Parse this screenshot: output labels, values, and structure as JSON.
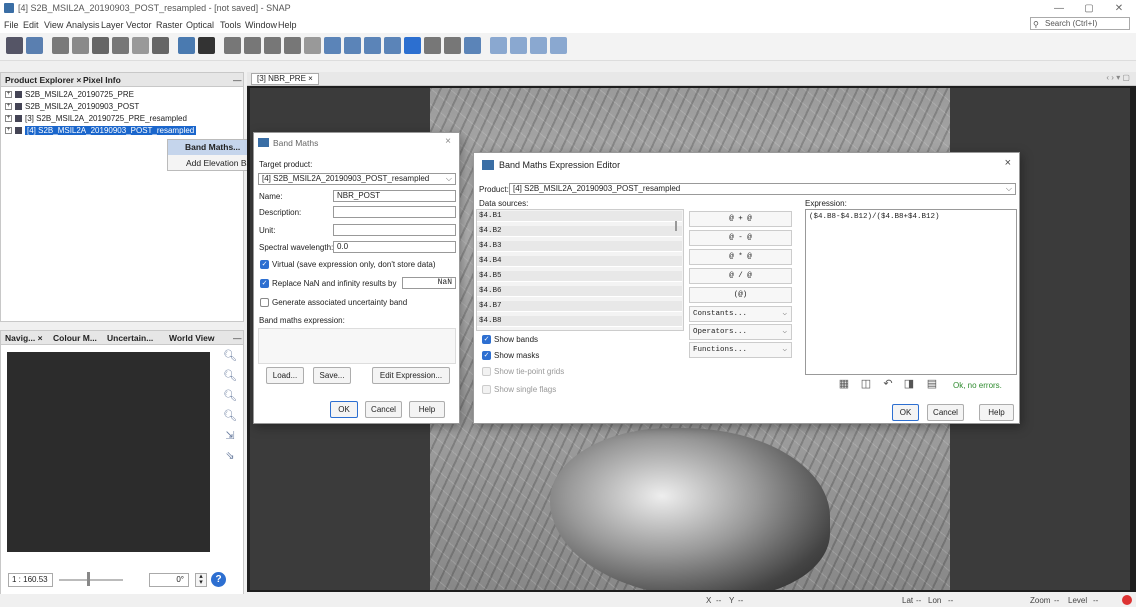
{
  "window": {
    "title": "[4] S2B_MSIL2A_20190903_POST_resampled - [not saved] - SNAP",
    "controls": [
      "—",
      "▢",
      "✕"
    ]
  },
  "menu": [
    "File",
    "Edit",
    "View",
    "Analysis",
    "Layer",
    "Vector",
    "Raster",
    "Optical",
    "Tools",
    "Window",
    "Help"
  ],
  "search": {
    "placeholder": "Search (Ctrl+I)"
  },
  "product_explorer": {
    "tabs": [
      "Product Explorer ×",
      "Pixel Info"
    ],
    "products": [
      "S2B_MSIL2A_20190725_PRE",
      "S2B_MSIL2A_20190903_POST",
      "[3] S2B_MSIL2A_20190725_PRE_resampled",
      "[4] S2B_MSIL2A_20190903_POST_resampled"
    ]
  },
  "context_menu": {
    "items": [
      "Band Maths...",
      "Add Elevation Ba"
    ]
  },
  "nav_panel": {
    "tabs": [
      "Navig... ×",
      "Colour M...",
      "Uncertain...",
      "World View"
    ],
    "scale": "1 : 160.53",
    "rotation": "0°"
  },
  "document_tab": {
    "label": "[3] NBR_PRE ×"
  },
  "band_maths": {
    "title": "Band Maths",
    "target_product_label": "Target product:",
    "target_product": "[4] S2B_MSIL2A_20190903_POST_resampled",
    "name_label": "Name:",
    "name_value": "NBR_POST",
    "description_label": "Description:",
    "unit_label": "Unit:",
    "wavelength_label": "Spectral wavelength:",
    "wavelength_value": "0.0",
    "virtual_label": "Virtual (save expression only, don't store data)",
    "replace_nan_label": "Replace NaN and infinity results by",
    "replace_nan_value": "NaN",
    "uncertainty_label": "Generate associated uncertainty band",
    "expression_label": "Band maths expression:",
    "load_button": "Load...",
    "save_button": "Save...",
    "edit_button": "Edit Expression...",
    "ok_button": "OK",
    "cancel_button": "Cancel",
    "help_button": "Help"
  },
  "expression_editor": {
    "title": "Band Maths Expression Editor",
    "product_label": "Product:",
    "product_value": "[4] S2B_MSIL2A_20190903_POST_resampled",
    "data_sources_label": "Data sources:",
    "data_sources": [
      "$4.B1",
      "$4.B2",
      "$4.B3",
      "$4.B4",
      "$4.B5",
      "$4.B6",
      "$4.B7",
      "$4.B8"
    ],
    "operators": [
      "@ + @",
      "@ - @",
      "@ * @",
      "@ / @",
      "(@)"
    ],
    "dropdowns": [
      "Constants...",
      "Operators...",
      "Functions..."
    ],
    "show_bands": "Show bands",
    "show_masks": "Show masks",
    "show_tie_point_grids": "Show tie-point grids",
    "show_single_flags": "Show single flags",
    "expression_label": "Expression:",
    "expression": "($4.B8-$4.B12)/($4.B8+$4.B12)",
    "status": "Ok, no errors.",
    "status_color": "#2e8b2e",
    "ok_button": "OK",
    "cancel_button": "Cancel",
    "help_button": "Help"
  },
  "statusbar": {
    "x": "X",
    "x_val": "--",
    "y": "Y",
    "y_val": "--",
    "lat": "Lat",
    "lat_val": "--",
    "lon": "Lon",
    "lon_val": "--",
    "zoom": "Zoom",
    "zoom_val": "--",
    "level": "Level",
    "level_val": "--"
  },
  "colors": {
    "selection": "#1a66cc",
    "accent": "#2d6fd1"
  }
}
